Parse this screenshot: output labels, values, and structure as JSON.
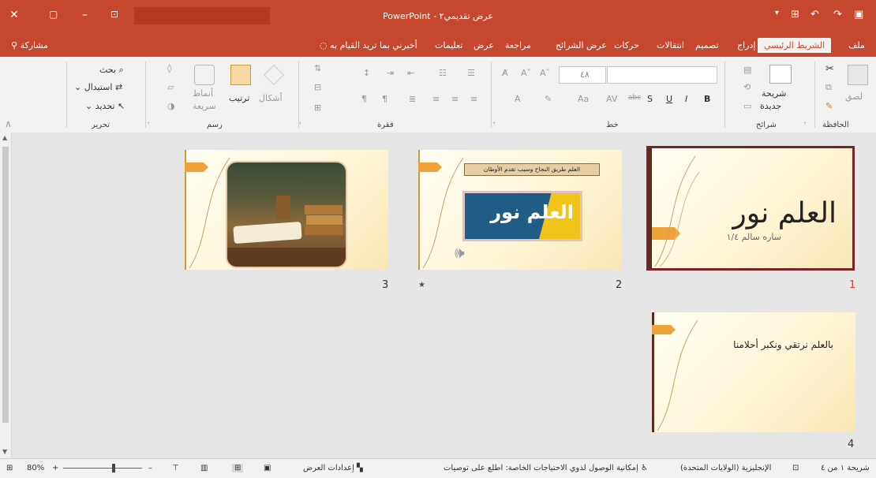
{
  "titlebar": {
    "app_name": "PowerPoint",
    "doc_title": "عرض تقديمي٢",
    "separator": " - "
  },
  "tabs": [
    {
      "label": "ملف"
    },
    {
      "label": "الشريط الرئيسي"
    },
    {
      "label": "إدراج"
    },
    {
      "label": "تصميم"
    },
    {
      "label": "انتقالات"
    },
    {
      "label": "حركات"
    },
    {
      "label": "عرض الشرائح"
    },
    {
      "label": "مراجعة"
    },
    {
      "label": "عرض"
    },
    {
      "label": "تعليمات"
    },
    {
      "label": "أخبرني بما تريد القيام به"
    }
  ],
  "share_label": "مشاركة",
  "ribbon": {
    "clipboard": {
      "paste": "لصق",
      "group": "الحافظة"
    },
    "slides": {
      "new_slide_line1": "شريحة",
      "new_slide_line2": "جديدة",
      "group": "شرائح"
    },
    "font": {
      "size": "٤٨",
      "bold": "B",
      "italic": "I",
      "underline": "U",
      "strike": "S",
      "spacing": "AV",
      "case": "Aa",
      "color_a": "A",
      "group": "خط"
    },
    "paragraph": {
      "group": "فقرة"
    },
    "drawing": {
      "shapes": "أشكال",
      "arrange": "ترتيب",
      "quick_styles_1": "أنماط",
      "quick_styles_2": "سريعة",
      "group": "رسم"
    },
    "editing": {
      "find": "بحث",
      "replace": "استبدال",
      "select": "تحديد",
      "group": "تحرير"
    }
  },
  "slides": [
    {
      "number": "1",
      "title": "العلم نور",
      "subtitle": "ساره سالم ١/٤"
    },
    {
      "number": "2",
      "banner": "العلم طريق النجاح وسبب تقدم الأوطان",
      "image_text": "العلم نور"
    },
    {
      "number": "3"
    },
    {
      "number": "4",
      "text": "بالعلم نرتقي ونكبر أحلامنا"
    }
  ],
  "statusbar": {
    "slide_info": "شريحة ١ من ٤",
    "language": "الإنجليزية (الولايات المتحدة)",
    "accessibility": "إمكانية الوصول لذوي الاحتياجات الخاصة: اطلع على توصيات",
    "presenter": "إعدادات العرض",
    "zoom": "80%"
  },
  "colors": {
    "accent": "#c7472e",
    "selected_border": "#7a2326"
  }
}
